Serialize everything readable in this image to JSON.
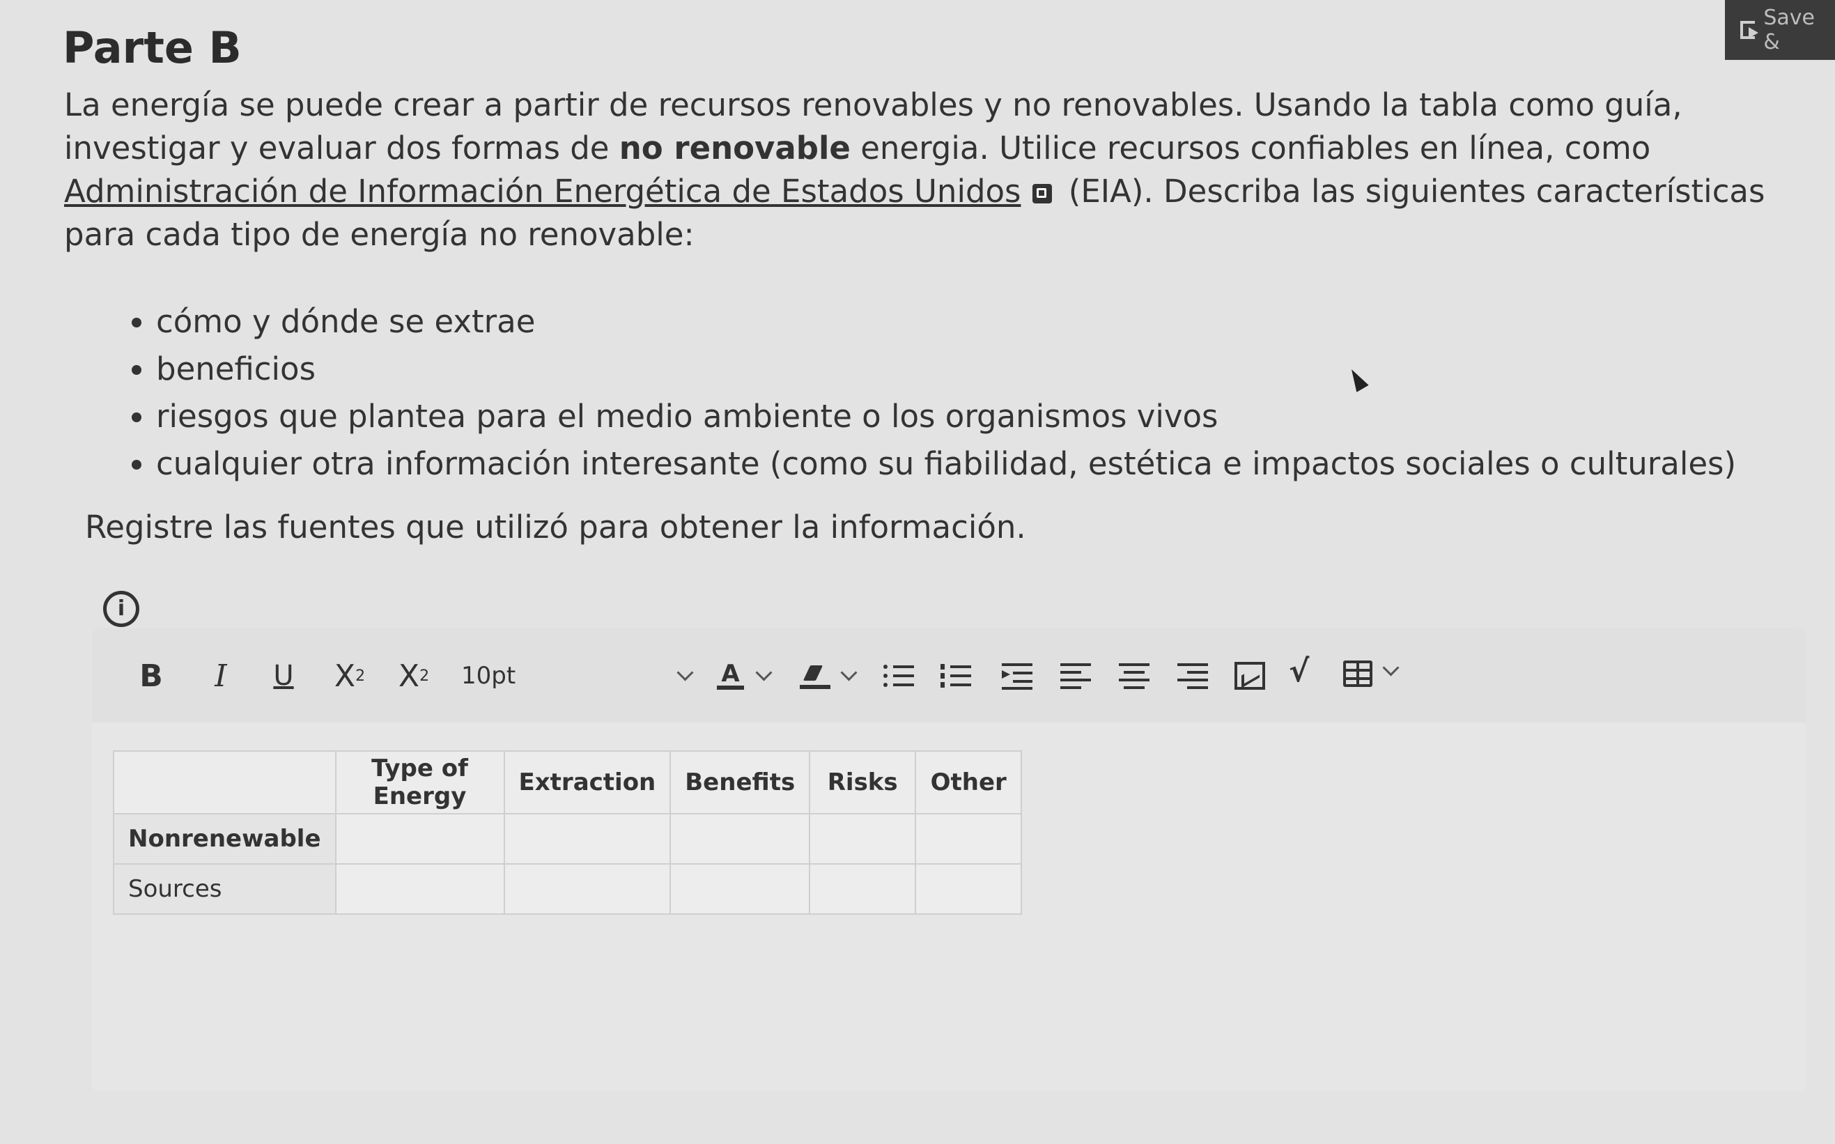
{
  "header": {
    "title": "Parte B",
    "save_label": "Save &"
  },
  "intro": {
    "p1": "La energía se puede crear a partir de recursos renovables y no renovables. Usando la tabla como guía, investigar y evaluar dos formas de ",
    "p1_bold": "no renovable",
    "p2": " energia. Utilice recursos confiables en línea, como ",
    "link": "Administración de Información Energética de Estados Unidos",
    "p3": " (EIA). Describa las siguientes características para cada tipo de energía no renovable:"
  },
  "bullets": [
    "cómo y dónde se extrae",
    "beneficios",
    "riesgos que plantea para el medio ambiente o los organismos vivos",
    "cualquier otra información interesante (como su fiabilidad, estética e impactos sociales o culturales)"
  ],
  "sources_note": "Registre las fuentes que utilizó para obtener la información.",
  "info_icon": "i",
  "toolbar": {
    "bold": "B",
    "italic": "I",
    "underline": "U",
    "superscript_base": "X",
    "superscript_exp": "2",
    "subscript_base": "X",
    "subscript_exp": "2",
    "font_size": "10pt",
    "font_color_glyph": "A",
    "sqrt_glyph": "√"
  },
  "table": {
    "headers": [
      "",
      "Type of Energy",
      "Extraction",
      "Benefits",
      "Risks",
      "Other"
    ],
    "rows": [
      [
        "Nonrenewable",
        "",
        "",
        "",
        "",
        ""
      ],
      [
        "Sources",
        "",
        "",
        "",
        "",
        ""
      ]
    ]
  }
}
